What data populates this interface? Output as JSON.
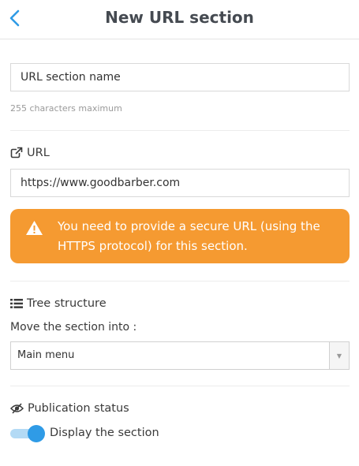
{
  "header": {
    "title": "New URL section",
    "back_icon": "chevron-left-icon",
    "accent_color": "#2f9be6"
  },
  "section_name": {
    "placeholder": "URL section name",
    "value": "URL section name",
    "help": "255 characters maximum"
  },
  "url": {
    "label": "URL",
    "icon": "external-link-icon",
    "value": "https://www.goodbarber.com"
  },
  "warning": {
    "icon": "warning-triangle-icon",
    "text": "You need to provide a secure URL (using the HTTPS protocol) for this section.",
    "color": "#f59a31"
  },
  "tree": {
    "label": "Tree structure",
    "icon": "list-icon",
    "move_label": "Move the section into :",
    "selected": "Main menu"
  },
  "publication": {
    "label": "Publication status",
    "icon": "eye-slash-icon",
    "toggle_label": "Display the section",
    "toggle_on": true
  }
}
